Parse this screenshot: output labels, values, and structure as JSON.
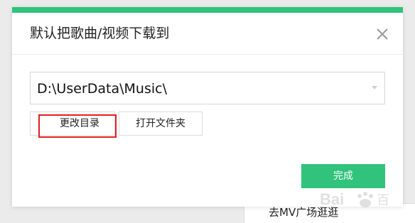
{
  "dialog": {
    "title": "默认把歌曲/视频下载到",
    "close_icon": "close-icon",
    "accent_color": "#31c27c"
  },
  "path_field": {
    "value": "D:\\UserData\\Music\\",
    "dropdown_icon": "chevron-down-icon"
  },
  "buttons": {
    "change_dir": "更改目录",
    "open_folder": "打开文件夹",
    "done": "完成"
  },
  "highlight_color": "#e02020",
  "background_app": {
    "link_text": "去MV广场逛逛"
  }
}
